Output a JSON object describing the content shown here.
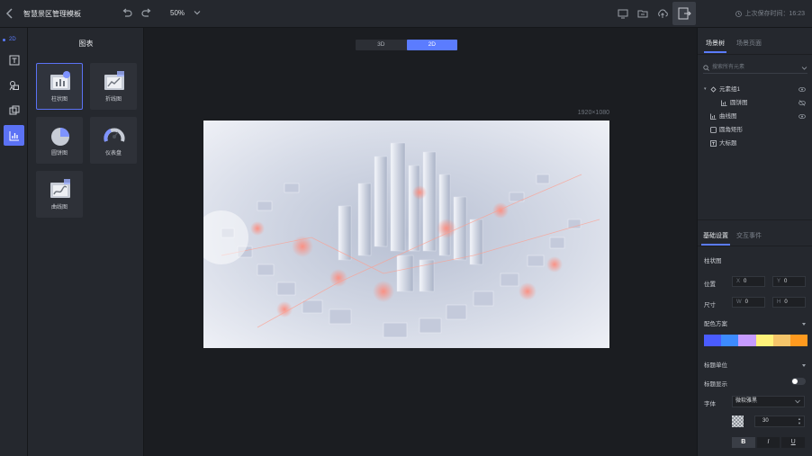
{
  "app": {
    "title": "智慧景区管理模板",
    "zoom": "50%",
    "save_status": "上次保存时间：16:23"
  },
  "left_rail": {
    "mode_label": "2D",
    "items": [
      "text-tool",
      "shapes-tool",
      "layers-tool",
      "chart-tool"
    ],
    "active": "chart-tool"
  },
  "library": {
    "title": "图表",
    "charts": [
      {
        "label": "柱状图",
        "icon": "bar-chart-icon",
        "selected": true
      },
      {
        "label": "折线图",
        "icon": "line-chart-icon",
        "selected": false
      },
      {
        "label": "圆饼图",
        "icon": "pie-chart-icon",
        "selected": false
      },
      {
        "label": "仪表盘",
        "icon": "gauge-icon",
        "selected": false
      },
      {
        "label": "曲线图",
        "icon": "curve-chart-icon",
        "selected": false
      }
    ]
  },
  "canvas": {
    "modes": [
      "3D",
      "2D"
    ],
    "active_mode": "2D",
    "size": "1920×1080",
    "image_description_icon": "city-aerial-image"
  },
  "right_panel": {
    "tabs": [
      "场景树",
      "场景页面"
    ],
    "active_tab": "场景树",
    "search_placeholder": "搜索所有元素",
    "tree": [
      {
        "label": "元素组1",
        "icon": "group-icon",
        "level": 0,
        "visible": "eye-icon",
        "expanded": true
      },
      {
        "label": "圆饼图",
        "icon": "chart-icon",
        "level": 1,
        "visible": "eye-off-icon"
      },
      {
        "label": "曲线图",
        "icon": "chart-icon",
        "level": 0,
        "visible": "eye-icon"
      },
      {
        "label": "圆角矩形",
        "icon": "rect-icon",
        "level": 0
      },
      {
        "label": "大标题",
        "icon": "text-icon",
        "level": 0
      }
    ],
    "props_tabs": [
      "基础设置",
      "交互事件"
    ],
    "active_props_tab": "基础设置",
    "component_name": "柱状图",
    "position_label": "位置",
    "position_x_key": "X",
    "position_x": "0",
    "position_y_key": "Y",
    "position_y": "0",
    "size_label": "尺寸",
    "size_w_key": "W",
    "size_w": "0",
    "size_h_key": "H",
    "size_h": "0",
    "color_scheme_label": "配色方案",
    "color_scheme": [
      "#4a5cff",
      "#3d8bff",
      "#c69bff",
      "#fff27a",
      "#f5c56a",
      "#ff9a1f"
    ],
    "title_unit_label": "标题单位",
    "title_show_label": "标题显示",
    "title_show": false,
    "font_label": "字体",
    "font_value": "微软雅黑",
    "font_size": "30",
    "format_buttons": [
      "B",
      "I",
      "U"
    ],
    "format_active": "B"
  },
  "toolbar_icons": [
    "preview-icon",
    "folder-icon",
    "cloud-upload-icon",
    "exit-icon"
  ]
}
